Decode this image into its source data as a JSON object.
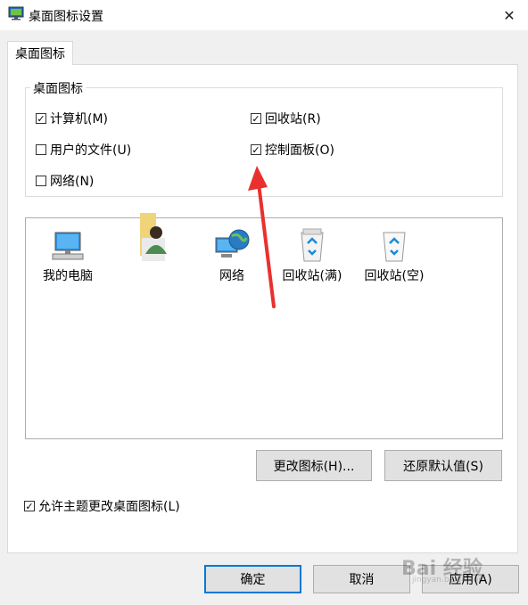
{
  "window": {
    "title": "桌面图标设置",
    "close_glyph": "✕"
  },
  "tabs": [
    {
      "label": "桌面图标"
    }
  ],
  "group": {
    "legend": "桌面图标",
    "checkboxes": [
      {
        "label": "计算机(M)",
        "checked": true
      },
      {
        "label": "回收站(R)",
        "checked": true
      },
      {
        "label": "用户的文件(U)",
        "checked": false
      },
      {
        "label": "控制面板(O)",
        "checked": true
      },
      {
        "label": "网络(N)",
        "checked": false
      }
    ]
  },
  "icons": [
    {
      "label": "我的电脑",
      "icon": "computer-icon"
    },
    {
      "label": "",
      "icon": "user-files-icon"
    },
    {
      "label": "网络",
      "icon": "network-icon"
    },
    {
      "label": "回收站(满)",
      "icon": "recycle-bin-full-icon"
    },
    {
      "label": "回收站(空)",
      "icon": "recycle-bin-empty-icon"
    }
  ],
  "buttons": {
    "change_icon": "更改图标(H)...",
    "restore_default": "还原默认值(S)",
    "ok": "确定",
    "cancel": "取消",
    "apply": "应用(A)"
  },
  "allow_themes": {
    "label": "允许主题更改桌面图标(L)",
    "checked": true
  },
  "colors": {
    "accent": "#0078d7",
    "arrow": "#e8312f"
  },
  "watermark": {
    "text": "Bai 经验",
    "sub": "jingyan.baidu.com"
  }
}
